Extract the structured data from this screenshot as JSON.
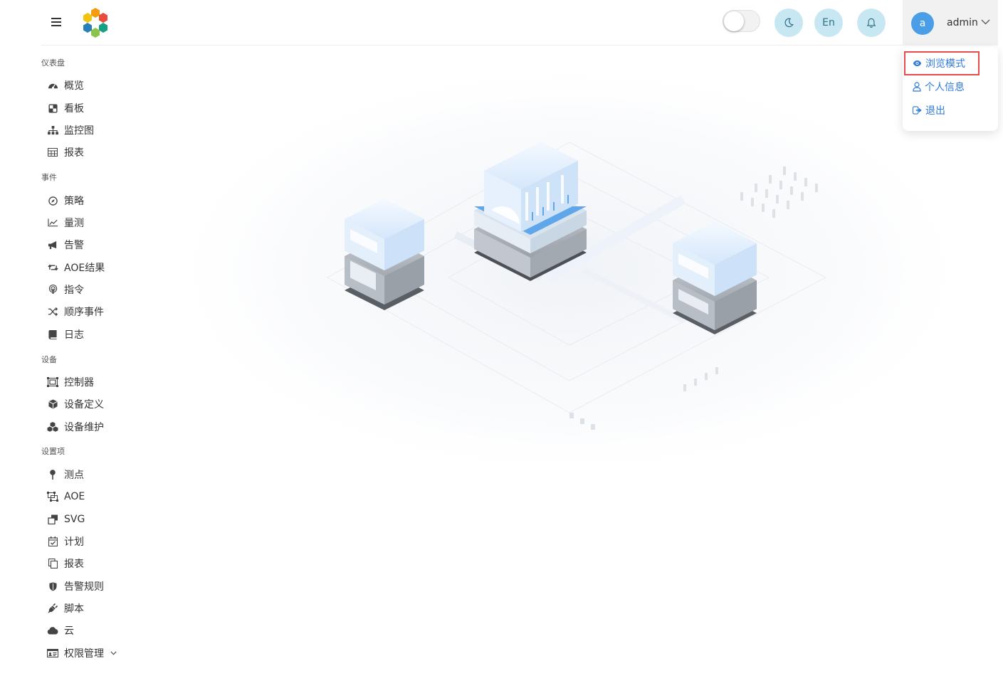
{
  "header": {
    "lang_label": "En",
    "avatar_initial": "a",
    "username": "admin"
  },
  "user_menu": {
    "items": [
      {
        "label": "浏览模式"
      },
      {
        "label": "个人信息"
      },
      {
        "label": "退出"
      }
    ]
  },
  "sidebar": {
    "sections": [
      {
        "title": "仪表盘",
        "items": [
          {
            "label": "概览",
            "icon": "dashboard-gauge-icon"
          },
          {
            "label": "看板",
            "icon": "board-icon"
          },
          {
            "label": "监控图",
            "icon": "sitemap-icon"
          },
          {
            "label": "报表",
            "icon": "table-icon"
          }
        ]
      },
      {
        "title": "事件",
        "items": [
          {
            "label": "策略",
            "icon": "compass-icon"
          },
          {
            "label": "量测",
            "icon": "line-chart-icon"
          },
          {
            "label": "告警",
            "icon": "bullhorn-icon"
          },
          {
            "label": "AOE结果",
            "icon": "retweet-icon"
          },
          {
            "label": "指令",
            "icon": "podcast-icon"
          },
          {
            "label": "顺序事件",
            "icon": "shuffle-icon"
          },
          {
            "label": "日志",
            "icon": "book-icon"
          }
        ]
      },
      {
        "title": "设备",
        "items": [
          {
            "label": "控制器",
            "icon": "object-group-icon"
          },
          {
            "label": "设备定义",
            "icon": "cube-icon"
          },
          {
            "label": "设备维护",
            "icon": "cubes-icon"
          }
        ]
      },
      {
        "title": "设置项",
        "items": [
          {
            "label": "测点",
            "icon": "map-pin-icon"
          },
          {
            "label": "AOE",
            "icon": "object-ungroup-icon"
          },
          {
            "label": "SVG",
            "icon": "clone-icon"
          },
          {
            "label": "计划",
            "icon": "calendar-check-icon"
          },
          {
            "label": "报表",
            "icon": "copy-icon"
          },
          {
            "label": "告警规则",
            "icon": "shield-icon"
          },
          {
            "label": "脚本",
            "icon": "plug-icon"
          },
          {
            "label": "云",
            "icon": "cloud-icon"
          },
          {
            "label": "权限管理",
            "icon": "id-card-icon"
          }
        ]
      }
    ]
  },
  "colors": {
    "accent": "#2f7ad8",
    "highlight": "#e74c4c",
    "header_button_bg": "#c7e8f2",
    "avatar_bg": "#4a9ee8"
  }
}
